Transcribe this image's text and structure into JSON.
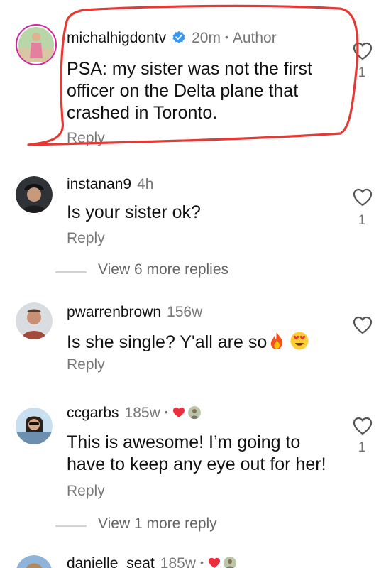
{
  "comments": [
    {
      "username": "michalhigdontv",
      "verified": true,
      "time": "20m",
      "badge": "Author",
      "text_lines": [
        "PSA: my sister was not the first",
        "officer on the Delta plane that",
        "crashed in Toronto."
      ],
      "reply_label": "Reply",
      "like_count": "1"
    },
    {
      "username": "instanan9",
      "time": "4h",
      "text_lines": [
        "Is your sister ok?"
      ],
      "reply_label": "Reply",
      "like_count": "1",
      "view_more": "View 6 more replies"
    },
    {
      "username": "pwarrenbrown",
      "time": "156w",
      "text": "Is she single? Y'all are so",
      "emojis": [
        "fire-emoji",
        "heart-eyes-emoji"
      ],
      "reply_label": "Reply",
      "like_count": ""
    },
    {
      "username": "ccgarbs",
      "time": "185w",
      "reaction": "liked-by-author",
      "text_lines": [
        "This is awesome! I’m going to",
        "have to keep any eye out for her!"
      ],
      "reply_label": "Reply",
      "like_count": "1",
      "view_more": "View 1 more reply"
    },
    {
      "username": "danielle_seat",
      "time": "185w",
      "reaction": "liked-by-author"
    }
  ],
  "annotation": {
    "color": "#e53935",
    "shape": "hand-drawn-oval"
  },
  "colors": {
    "verified": "#3897f0",
    "heart_red": "#ed2c3c",
    "secondary_text": "#777777"
  },
  "icons": [
    "heart-outline-icon",
    "verified-badge-icon",
    "liked-heart-icon"
  ]
}
